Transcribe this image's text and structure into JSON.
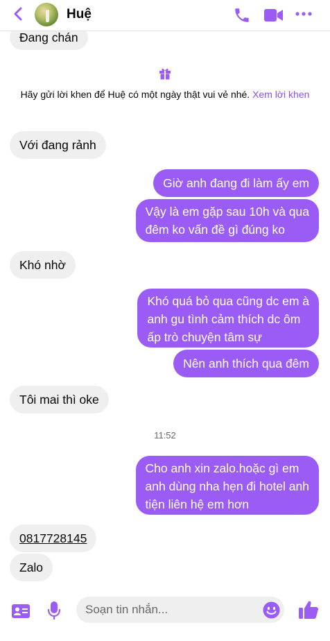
{
  "header": {
    "contact_name": "Huệ",
    "icons": [
      "back-chevron-icon",
      "phone-icon",
      "video-camera-icon",
      "more-icon"
    ]
  },
  "messages": {
    "partial_top": "Đang chán",
    "system_notice": {
      "icon": "gift-icon",
      "text": "Hãy gửi lời khen để Huệ có một ngày thật vui vẻ nhé.",
      "link": "Xem lời khen"
    },
    "in_1": "Với đang rảnh",
    "out_1": "Giờ anh đang đi làm ấy em",
    "out_2": [
      "Vậy là em gặp sau 10h và qua",
      "đêm ko vấn đề gì đúng ko"
    ],
    "in_2": "Khó nhờ",
    "out_3": [
      "Khó quá bỏ qua cũng dc em à",
      "anh gu tình cảm thích dc ôm",
      "ấp trò chuyện tâm sự"
    ],
    "out_4": "Nên anh thích qua đêm",
    "in_3": "Tôi mai thì oke",
    "timestamp": "11:52",
    "out_5": [
      "Cho anh xin zalo.hoặc gì em",
      "anh dùng nha hẹn đi hotel anh",
      "tiện liên hệ em hơn"
    ],
    "in_4": "0817728145",
    "in_5": "Zalo"
  },
  "composer": {
    "placeholder": "Soạn tin nhắn...",
    "icons": [
      "contact-card-icon",
      "microphone-icon",
      "emoji-icon",
      "thumbs-up-icon"
    ]
  },
  "colors": {
    "accent": "#9a5cf4",
    "incoming_bubble": "#efefef"
  }
}
